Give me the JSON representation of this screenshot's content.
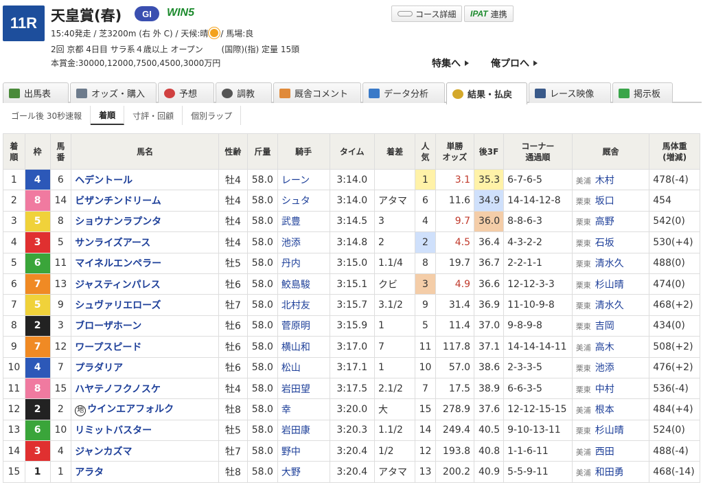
{
  "race": {
    "number": "11R",
    "name": "天皇賞(春)",
    "grade": "GI",
    "win5": "WIN5",
    "line1a": "15:40発走 / 芝3200m (右 外 C) / 天候:晴",
    "line1b": "/ 馬場:良",
    "line2": "2回 京都 4日目 サラ系４歳以上 オープン       (国際)(指) 定量 15頭",
    "line3": "本賞金:30000,12000,7500,4500,3000万円"
  },
  "buttons": {
    "course": "コース詳細",
    "ipat": "IPAT",
    "ipat_suffix": "連携"
  },
  "links": {
    "feature": "特集へ",
    "pro": "俺プロへ"
  },
  "tabs": [
    {
      "label": "出馬表"
    },
    {
      "label": "オッズ・購入"
    },
    {
      "label": "予想"
    },
    {
      "label": "調教"
    },
    {
      "label": "厩舎コメント"
    },
    {
      "label": "データ分析"
    },
    {
      "label": "結果・払戻"
    },
    {
      "label": "レース映像"
    },
    {
      "label": "掲示板"
    }
  ],
  "subtabs": [
    {
      "label": "ゴール後 30秒速報"
    },
    {
      "label": "着順"
    },
    {
      "label": "寸評・回顧"
    },
    {
      "label": "個別ラップ"
    }
  ],
  "headers": [
    "着順",
    "枠",
    "馬番",
    "馬名",
    "性齢",
    "斤量",
    "騎手",
    "タイム",
    "着差",
    "人気",
    "単勝オッズ",
    "後3F",
    "コーナー通過順",
    "厩舎",
    "馬体重(増減)"
  ],
  "rows": [
    {
      "rank": "1",
      "waku": "4",
      "num": "6",
      "horse": "ヘデントール",
      "sex": "牡4",
      "weight": "58.0",
      "jockey": "レーン",
      "time": "3:14.0",
      "margin": "",
      "pop": "1",
      "odds": "3.1",
      "f3": "35.3",
      "corner": "6-7-6-5",
      "area": "美浦",
      "trainer": "木村",
      "body": "478(-4)"
    },
    {
      "rank": "2",
      "waku": "8",
      "num": "14",
      "horse": "ビザンチンドリーム",
      "sex": "牡4",
      "weight": "58.0",
      "jockey": "シュタ",
      "time": "3:14.0",
      "margin": "アタマ",
      "pop": "6",
      "odds": "11.6",
      "f3": "34.9",
      "corner": "14-14-12-8",
      "area": "栗東",
      "trainer": "坂口",
      "body": "454"
    },
    {
      "rank": "3",
      "waku": "5",
      "num": "8",
      "horse": "ショウナンラプンタ",
      "sex": "牡4",
      "weight": "58.0",
      "jockey": "武豊",
      "time": "3:14.5",
      "margin": "3",
      "pop": "4",
      "odds": "9.7",
      "f3": "36.0",
      "corner": "8-8-6-3",
      "area": "栗東",
      "trainer": "高野",
      "body": "542(0)"
    },
    {
      "rank": "4",
      "waku": "3",
      "num": "5",
      "horse": "サンライズアース",
      "sex": "牡4",
      "weight": "58.0",
      "jockey": "池添",
      "time": "3:14.8",
      "margin": "2",
      "pop": "2",
      "odds": "4.5",
      "f3": "36.4",
      "corner": "4-3-2-2",
      "area": "栗東",
      "trainer": "石坂",
      "body": "530(+4)"
    },
    {
      "rank": "5",
      "waku": "6",
      "num": "11",
      "horse": "マイネルエンペラー",
      "sex": "牡5",
      "weight": "58.0",
      "jockey": "丹内",
      "time": "3:15.0",
      "margin": "1.1/4",
      "pop": "8",
      "odds": "19.7",
      "f3": "36.7",
      "corner": "2-2-1-1",
      "area": "栗東",
      "trainer": "清水久",
      "body": "488(0)"
    },
    {
      "rank": "6",
      "waku": "7",
      "num": "13",
      "horse": "ジャスティンパレス",
      "sex": "牡6",
      "weight": "58.0",
      "jockey": "鮫島駿",
      "time": "3:15.1",
      "margin": "クビ",
      "pop": "3",
      "odds": "4.9",
      "f3": "36.6",
      "corner": "12-12-3-3",
      "area": "栗東",
      "trainer": "杉山晴",
      "body": "474(0)"
    },
    {
      "rank": "7",
      "waku": "5",
      "num": "9",
      "horse": "シュヴァリエローズ",
      "sex": "牡7",
      "weight": "58.0",
      "jockey": "北村友",
      "time": "3:15.7",
      "margin": "3.1/2",
      "pop": "9",
      "odds": "31.4",
      "f3": "36.9",
      "corner": "11-10-9-8",
      "area": "栗東",
      "trainer": "清水久",
      "body": "468(+2)"
    },
    {
      "rank": "8",
      "waku": "2",
      "num": "3",
      "horse": "ブローザホーン",
      "sex": "牡6",
      "weight": "58.0",
      "jockey": "菅原明",
      "time": "3:15.9",
      "margin": "1",
      "pop": "5",
      "odds": "11.4",
      "f3": "37.0",
      "corner": "9-8-9-8",
      "area": "栗東",
      "trainer": "吉岡",
      "body": "434(0)"
    },
    {
      "rank": "9",
      "waku": "7",
      "num": "12",
      "horse": "ワープスピード",
      "sex": "牡6",
      "weight": "58.0",
      "jockey": "横山和",
      "time": "3:17.0",
      "margin": "7",
      "pop": "11",
      "odds": "117.8",
      "f3": "37.1",
      "corner": "14-14-14-11",
      "area": "美浦",
      "trainer": "高木",
      "body": "508(+2)"
    },
    {
      "rank": "10",
      "waku": "4",
      "num": "7",
      "horse": "プラダリア",
      "sex": "牡6",
      "weight": "58.0",
      "jockey": "松山",
      "time": "3:17.1",
      "margin": "1",
      "pop": "10",
      "odds": "57.0",
      "f3": "38.6",
      "corner": "2-3-3-5",
      "area": "栗東",
      "trainer": "池添",
      "body": "476(+2)"
    },
    {
      "rank": "11",
      "waku": "8",
      "num": "15",
      "horse": "ハヤテノフクノスケ",
      "sex": "牡4",
      "weight": "58.0",
      "jockey": "岩田望",
      "time": "3:17.5",
      "margin": "2.1/2",
      "pop": "7",
      "odds": "17.5",
      "f3": "38.9",
      "corner": "6-6-3-5",
      "area": "栗東",
      "trainer": "中村",
      "body": "536(-4)"
    },
    {
      "rank": "12",
      "waku": "2",
      "num": "2",
      "horse": "ウインエアフォルク",
      "mark": "地",
      "sex": "牡8",
      "weight": "58.0",
      "jockey": "幸",
      "time": "3:20.0",
      "margin": "大",
      "pop": "15",
      "odds": "278.9",
      "f3": "37.6",
      "corner": "12-12-15-15",
      "area": "美浦",
      "trainer": "根本",
      "body": "484(+4)"
    },
    {
      "rank": "13",
      "waku": "6",
      "num": "10",
      "horse": "リミットバスター",
      "sex": "牡5",
      "weight": "58.0",
      "jockey": "岩田康",
      "time": "3:20.3",
      "margin": "1.1/2",
      "pop": "14",
      "odds": "249.4",
      "f3": "40.5",
      "corner": "9-10-13-11",
      "area": "栗東",
      "trainer": "杉山晴",
      "body": "524(0)"
    },
    {
      "rank": "14",
      "waku": "3",
      "num": "4",
      "horse": "ジャンカズマ",
      "sex": "牡7",
      "weight": "58.0",
      "jockey": "野中",
      "time": "3:20.4",
      "margin": "1/2",
      "pop": "12",
      "odds": "193.8",
      "f3": "40.8",
      "corner": "1-1-6-11",
      "area": "美浦",
      "trainer": "西田",
      "body": "488(-4)"
    },
    {
      "rank": "15",
      "waku": "1",
      "num": "1",
      "horse": "アラタ",
      "sex": "牡8",
      "weight": "58.0",
      "jockey": "大野",
      "time": "3:20.4",
      "margin": "アタマ",
      "pop": "13",
      "odds": "200.2",
      "f3": "40.9",
      "corner": "5-5-9-11",
      "area": "美浦",
      "trainer": "和田勇",
      "body": "468(-14)"
    }
  ],
  "waku_colors": {
    "1": {
      "bg": "#ffffff",
      "fg": "#222222"
    },
    "2": {
      "bg": "#222222",
      "fg": "#ffffff"
    },
    "3": {
      "bg": "#e03030",
      "fg": "#ffffff"
    },
    "4": {
      "bg": "#2c58b8",
      "fg": "#ffffff"
    },
    "5": {
      "bg": "#f0d23a",
      "fg": "#ffffff"
    },
    "6": {
      "bg": "#3aa53a",
      "fg": "#ffffff"
    },
    "7": {
      "bg": "#f08a24",
      "fg": "#ffffff"
    },
    "8": {
      "bg": "#f07aa0",
      "fg": "#ffffff"
    }
  }
}
